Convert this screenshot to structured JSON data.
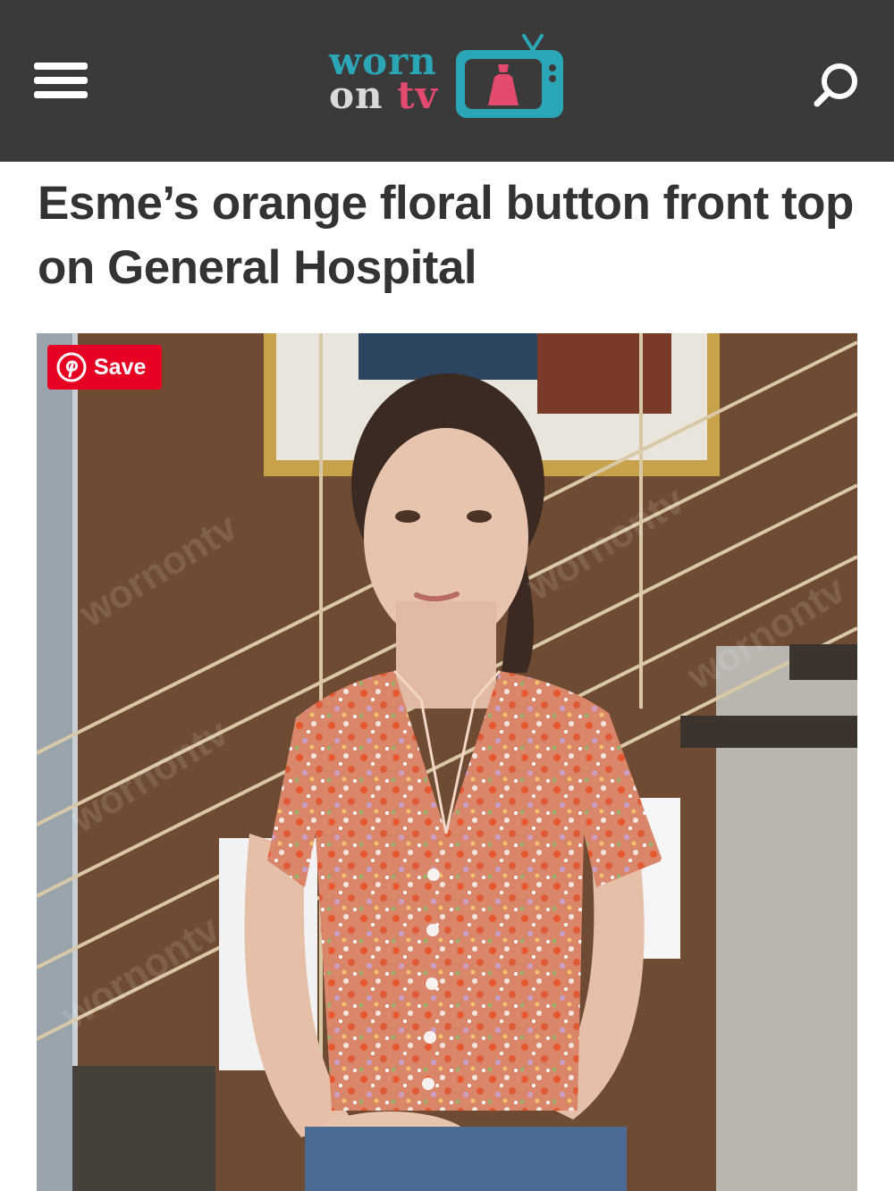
{
  "header": {
    "logo_line1": "worn",
    "logo_on": "on",
    "logo_tv": "tv"
  },
  "article": {
    "title": "Esme’s orange floral button front top on General Hospital"
  },
  "image": {
    "save_label": "Save"
  },
  "icons": {
    "menu": "hamburger-menu-icon",
    "search": "search-icon",
    "pinterest": "pinterest-icon",
    "logo_tv": "tv-dress-icon"
  },
  "colors": {
    "header_bg": "#3a3a3a",
    "logo_teal": "#2aa6b6",
    "logo_pink": "#e44a6e",
    "pinterest_red": "#e60023",
    "title_text": "#333333"
  }
}
